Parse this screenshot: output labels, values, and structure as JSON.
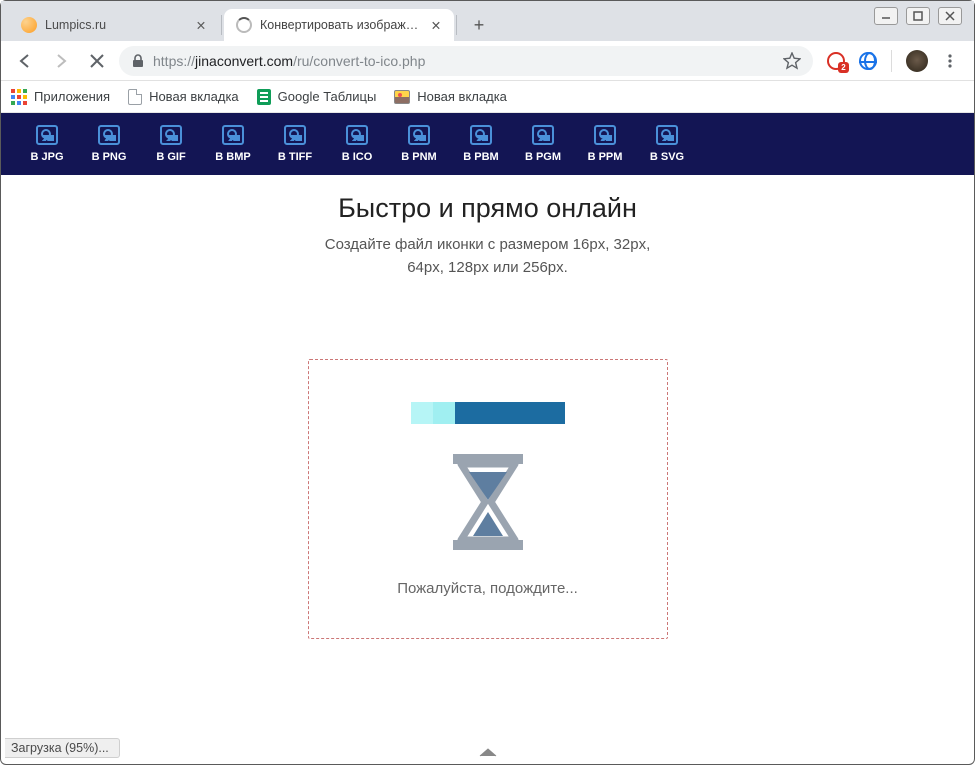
{
  "window": {
    "tabs": [
      {
        "title": "Lumpics.ru",
        "active": false
      },
      {
        "title": "Конвертировать изображения",
        "active": true
      }
    ]
  },
  "toolbar": {
    "url_scheme": "https://",
    "url_host": "jinaconvert.com",
    "url_path": "/ru/convert-to-ico.php"
  },
  "bookmarks": {
    "apps": "Приложения",
    "items": [
      {
        "label": "Новая вкладка",
        "icon": "doc"
      },
      {
        "label": "Google Таблицы",
        "icon": "sheets"
      },
      {
        "label": "Новая вкладка",
        "icon": "pic"
      }
    ]
  },
  "ext_badge": "2",
  "nav_formats": [
    "В JPG",
    "В PNG",
    "В GIF",
    "В BMP",
    "В TIFF",
    "В ICO",
    "В PNM",
    "В PBM",
    "В PGM",
    "В PPM",
    "В SVG"
  ],
  "page": {
    "heading": "Быстро и прямо онлайн",
    "sub_line1": "Создайте файл иконки с размером 16px, 32px,",
    "sub_line2": "64px, 128px или 256px.",
    "wait": "Пожалуйста, подождите..."
  },
  "status": "Загрузка (95%)..."
}
